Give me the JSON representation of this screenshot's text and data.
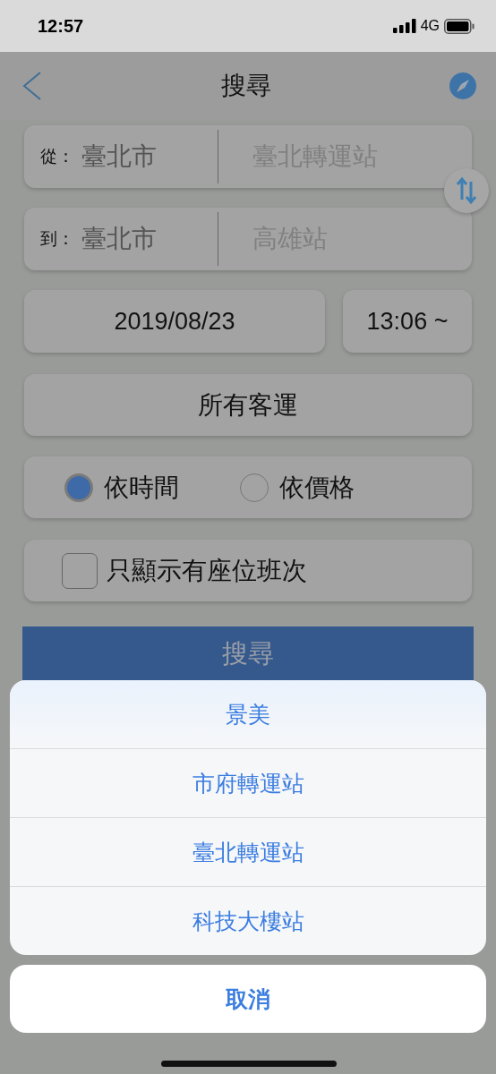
{
  "status_bar": {
    "time": "12:57",
    "network": "4G"
  },
  "nav": {
    "title": "搜尋"
  },
  "route": [
    {
      "label": "從：",
      "city": "臺北市",
      "station": "臺北轉運站"
    },
    {
      "label": "到：",
      "city": "臺北市",
      "station": "高雄站"
    }
  ],
  "date": "2019/08/23",
  "time": "13:06 ~",
  "company": "所有客運",
  "sort_options": [
    {
      "label": "依時間",
      "selected": true
    },
    {
      "label": "依價格",
      "selected": false
    }
  ],
  "seat_filter": {
    "label": "只顯示有座位班次",
    "checked": false
  },
  "search_button": "搜尋",
  "action_sheet": {
    "options": [
      "景美",
      "市府轉運站",
      "臺北轉運站",
      "科技大樓站"
    ],
    "cancel": "取消"
  }
}
